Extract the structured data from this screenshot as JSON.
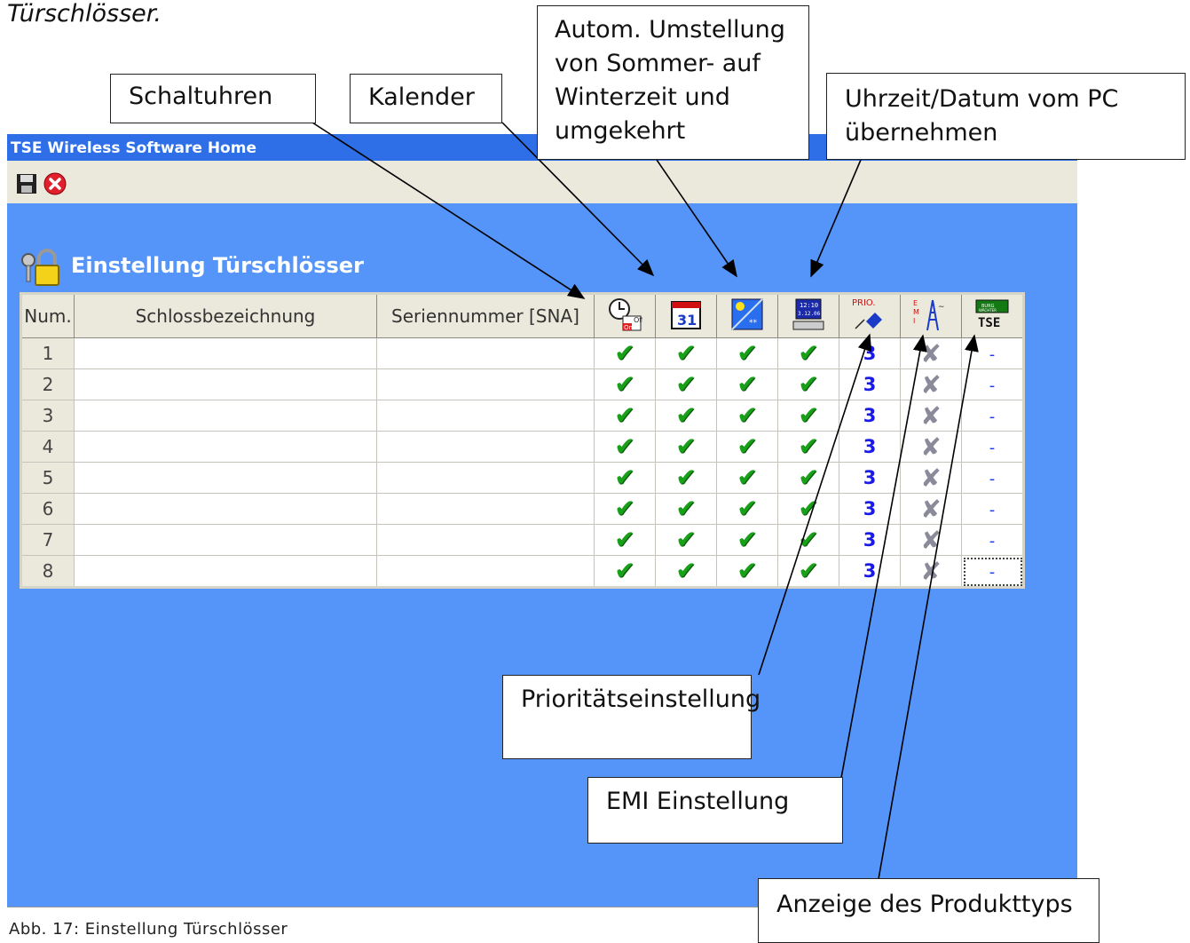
{
  "intro_text": "Türschlösser.",
  "window": {
    "title": "TSE Wireless Software Home",
    "toolbar": [
      {
        "icon": "floppy-disk-icon"
      },
      {
        "icon": "close-circle-icon"
      }
    ],
    "page_title": "Einstellung Türschlösser",
    "table": {
      "headers": {
        "num": "Num.",
        "name": "Schlossbezeichnung",
        "sna": "Seriennummer [SNA]"
      },
      "icon_headers": [
        {
          "icon": "timer-switch-icon",
          "text": "Off On"
        },
        {
          "icon": "calendar-icon",
          "text": "31"
        },
        {
          "icon": "summer-winter-icon",
          "text": ""
        },
        {
          "icon": "pc-clock-icon",
          "text": "12:10 3.12.06"
        },
        {
          "icon": "priority-icon",
          "text": "PRIO."
        },
        {
          "icon": "emi-antenna-icon",
          "text": "E M I"
        },
        {
          "icon": "tse-product-icon",
          "text": "TSE"
        }
      ],
      "rows": [
        {
          "num": "1",
          "name": "",
          "sna": "",
          "prio": "3",
          "product": "-"
        },
        {
          "num": "2",
          "name": "",
          "sna": "",
          "prio": "3",
          "product": "-"
        },
        {
          "num": "3",
          "name": "",
          "sna": "",
          "prio": "3",
          "product": "-"
        },
        {
          "num": "4",
          "name": "",
          "sna": "",
          "prio": "3",
          "product": "-"
        },
        {
          "num": "5",
          "name": "",
          "sna": "",
          "prio": "3",
          "product": "-"
        },
        {
          "num": "6",
          "name": "",
          "sna": "",
          "prio": "3",
          "product": "-"
        },
        {
          "num": "7",
          "name": "",
          "sna": "",
          "prio": "3",
          "product": "-"
        },
        {
          "num": "8",
          "name": "",
          "sna": "",
          "prio": "3",
          "product": "-"
        }
      ]
    }
  },
  "callouts": {
    "schaltuhren": "Schaltuhren",
    "kalender": "Kalender",
    "autom": "Autom. Umstellung von Sommer- auf Winterzeit und umgekehrt",
    "uhrzeit": "Uhrzeit/Datum vom PC übernehmen",
    "prioritaet": "Prioritätseinstellung",
    "emi": "EMI Einstellung",
    "produkt": "Anzeige des Produkttyps"
  },
  "caption": "Abb. 17: Einstellung Türschlösser",
  "colors": {
    "window_bg": "#5594f8",
    "titlebar": "#2e6fe8",
    "check": "#19a019",
    "prio": "#1a1ae8"
  }
}
